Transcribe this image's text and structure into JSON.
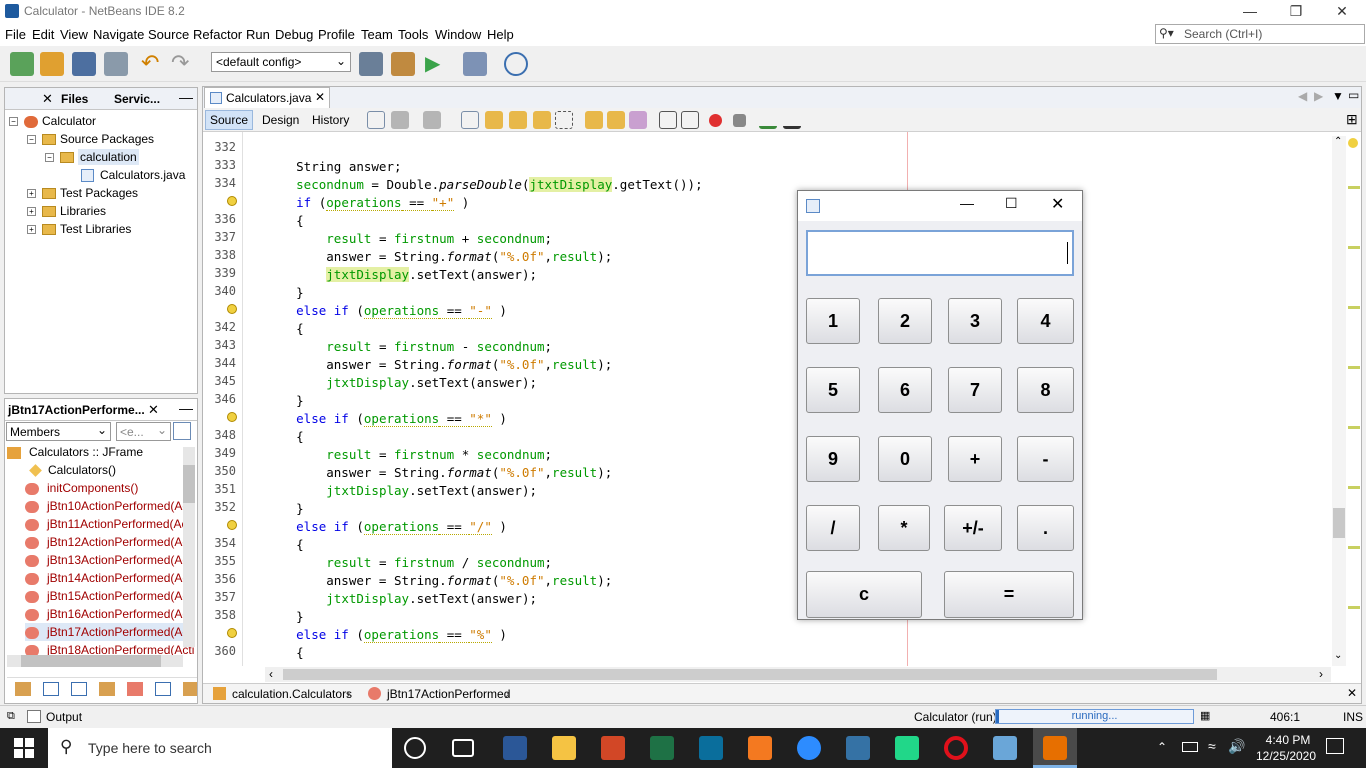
{
  "window": {
    "title": "Calculator - NetBeans IDE 8.2",
    "controls": [
      "—",
      "❐",
      "✕"
    ]
  },
  "menu": [
    "File",
    "Edit",
    "View",
    "Navigate",
    "Source",
    "Refactor",
    "Run",
    "Debug",
    "Profile",
    "Team",
    "Tools",
    "Window",
    "Help"
  ],
  "search": {
    "placeholder": "Search (Ctrl+I)"
  },
  "toolbar": {
    "config": "<default config>"
  },
  "projects": {
    "tabs": [
      "Files",
      "Servic..."
    ],
    "tree": [
      {
        "label": "Calculator",
        "level": 0,
        "kind": "project"
      },
      {
        "label": "Source Packages",
        "level": 1,
        "kind": "folder"
      },
      {
        "label": "calculation",
        "level": 2,
        "kind": "package"
      },
      {
        "label": "Calculators.java",
        "level": 3,
        "kind": "file"
      },
      {
        "label": "Test Packages",
        "level": 1,
        "kind": "folder"
      },
      {
        "label": "Libraries",
        "level": 1,
        "kind": "folder"
      },
      {
        "label": "Test Libraries",
        "level": 1,
        "kind": "folder"
      }
    ]
  },
  "navigator": {
    "title": "jBtn17ActionPerforme...",
    "filter": "Members",
    "filter2": "<e...",
    "items": [
      "Calculators :: JFrame",
      "Calculators()",
      "initComponents()",
      "jBtn10ActionPerformed(Acti",
      "jBtn11ActionPerformed(Acti",
      "jBtn12ActionPerformed(Acti",
      "jBtn13ActionPerformed(Acti",
      "jBtn14ActionPerformed(Acti",
      "jBtn15ActionPerformed(Acti",
      "jBtn16ActionPerformed(Acti",
      "jBtn17ActionPerformed(Acti",
      "jBtn18ActionPerformed(Acti"
    ]
  },
  "editor": {
    "tab": "Calculators.java",
    "modes": [
      "Source",
      "Design",
      "History"
    ],
    "line_numbers": [
      "332",
      "333",
      "334",
      "",
      "336",
      "337",
      "338",
      "339",
      "340",
      "",
      "342",
      "343",
      "344",
      "345",
      "346",
      "",
      "348",
      "349",
      "350",
      "351",
      "352",
      "",
      "354",
      "355",
      "356",
      "357",
      "358",
      "",
      "360"
    ],
    "breadcrumb": [
      "calculation.Calculators",
      "jBtn17ActionPerformed"
    ]
  },
  "calculator": {
    "display": "",
    "buttons": [
      "1",
      "2",
      "3",
      "4",
      "5",
      "6",
      "7",
      "8",
      "9",
      "0",
      "+",
      "-",
      "/",
      "*",
      "+/-",
      ".",
      "c",
      "="
    ]
  },
  "status": {
    "output": "Output",
    "run_label": "Calculator (run)",
    "progress": "running...",
    "position": "406:1",
    "mode": "INS"
  },
  "taskbar": {
    "search": "Type here to search",
    "time": "4:40 PM",
    "date": "12/25/2020"
  }
}
